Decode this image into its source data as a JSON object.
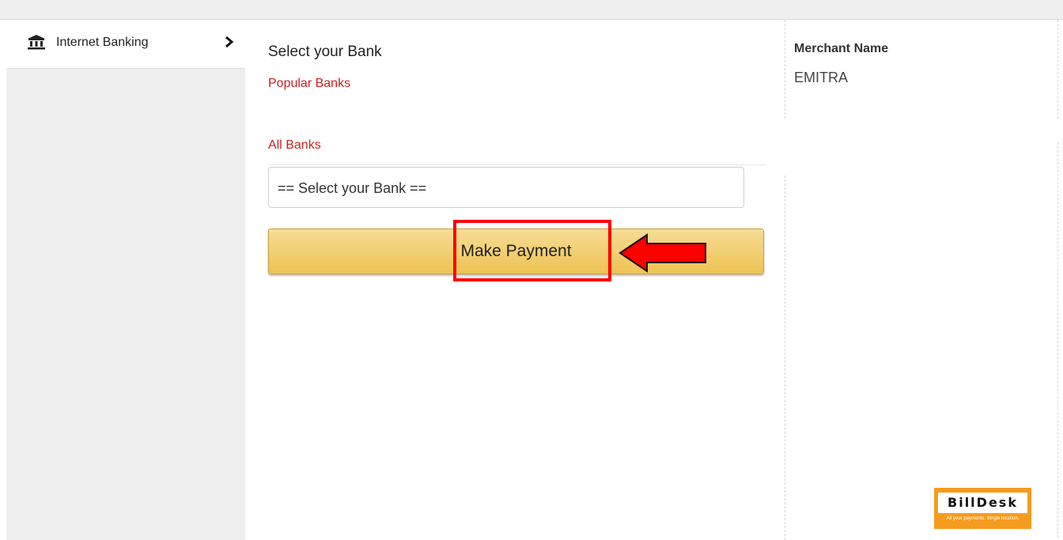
{
  "sidebar": {
    "items": [
      {
        "label": "Internet Banking",
        "icon": "bank-icon",
        "chevron": "chevron-right-icon",
        "active": true
      }
    ]
  },
  "main": {
    "title": "Select your Bank",
    "popular_label": "Popular Banks",
    "all_label": "All Banks",
    "bank_select": {
      "value": "== Select your Bank =="
    },
    "pay_button": "Make Payment"
  },
  "merchant": {
    "label": "Merchant Name",
    "value": "EMITRA"
  },
  "brand": {
    "name": "BillDesk",
    "tagline": "All your payments. Single location."
  },
  "annotations": {
    "highlight_color": "#ff0000",
    "arrow_color": "#ff0000"
  },
  "colors": {
    "accent_red": "#cc1f1f",
    "button_gold": "#efc353",
    "brand_orange": "#f59c1e"
  }
}
